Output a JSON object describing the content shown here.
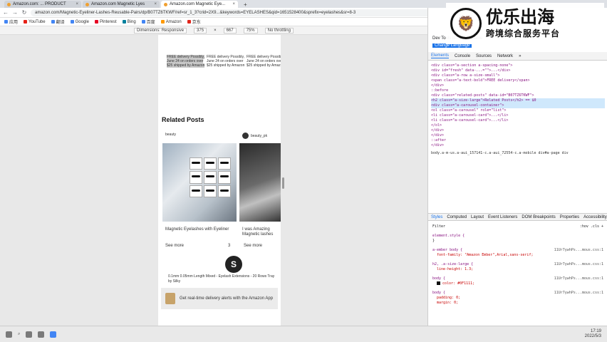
{
  "browser": {
    "tabs": [
      {
        "title": "Amazon.com: ... PRODUCT",
        "active": false
      },
      {
        "title": "Amazon.com Magnetic Lyes",
        "active": false
      },
      {
        "title": "Amazon.com Magnetic Eye...",
        "active": true
      }
    ],
    "url": "amazon.com/Magnetic-Eyeliner-Lashes-Reusable-Pairs/dp/B07TZ6TKWF/ref=sr_1_3?crid=2X9...&keywords=EYELASHES&qid=1651528400&sprefix=eyelashes&sr=8-3",
    "bookmarks": [
      "应用",
      "YouTube",
      "翻译",
      "Google",
      "Pinterest",
      "Bing",
      "百度",
      "Amazon",
      "京东"
    ]
  },
  "device_toolbar": {
    "device": "Dimensions: Responsive",
    "width": "375",
    "height": "667",
    "zoom": "75%",
    "throttle": "No throttling"
  },
  "page": {
    "delivery": [
      {
        "text": "FREE delivery Possibly, June 24 on orders over $25 shipped by Amazon"
      },
      {
        "text": "FREE delivery Possibly, June 24 on orders over $25 shipped by Amazon"
      },
      {
        "text": "FREE delivery Possibly, June 24 on orders over $25 shipped by Amazon"
      }
    ],
    "related_title": "Related Posts",
    "posts": [
      {
        "user": "beauty",
        "caption": "Magnetic Eyelashes with Eyeliner",
        "see_more": "See more",
        "count": "3"
      },
      {
        "user": "beauty_pk",
        "caption": "I was Amazing Magnetic lashes",
        "see_more": "See more",
        "count": ""
      }
    ],
    "badge": "S",
    "product_text": "0.1mm 0.05mm Length Mixed - Eyelash Extensions - 20 Rows Tray by Silky",
    "app_banner": "Get real-time delivery alerts with the Amazon App"
  },
  "devtools": {
    "tabs": [
      "Elements",
      "Console",
      "Sources",
      "Network",
      "»"
    ],
    "active_tab": "Elements",
    "header_1": "Dev Tools is now available",
    "header_2": "Change Language",
    "dom_lines": [
      "<div class=\"a-section a-spacing-none\">",
      "  <div id=\"fresh\" data-...=\"\">...</div>",
      "  <div class=\"a-row a-size-small\">",
      "    <span class=\"a-text-bold\">FREE delivery</span>",
      "  </div>",
      "  ::before",
      "  <div class=\"related-posts\" data-id=\"B07TZ6TKWF\">",
      "    <h2 class=\"a-size-large\">Related Posts</h2> == $0",
      "    <div class=\"a-carousel-container\">",
      "      <ol class=\"a-carousel\" role=\"list\">",
      "        <li class=\"a-carousel-card\">...</li>",
      "        <li class=\"a-carousel-card\">...</li>",
      "      </ol>",
      "    </div>",
      "  </div>",
      "  ::after",
      "</div>",
      "body.a-m-us.a-aui_157141-c.a-aui_72554-c.a-mobile  div#a-page  div"
    ],
    "subtabs": [
      "Styles",
      "Computed",
      "Layout",
      "Event Listeners",
      "DOM Breakpoints",
      "Properties",
      "Accessibility"
    ],
    "filter": "Filter",
    "filter_flags": ":hov .cls +",
    "styles": [
      {
        "selector": "element.style {",
        "source": "",
        "props": [
          "}"
        ]
      },
      {
        "selector": "a-ember body {",
        "source": "11Ur7ywhPs...mous.css:1",
        "props": [
          "font-family: \"Amazon Ember\",Arial,sans-serif;"
        ]
      },
      {
        "selector": "h2, .a-size-large {",
        "source": "11Ur7ywhPs...mous.css:1",
        "props": [
          "line-height: 1.3;"
        ]
      },
      {
        "selector": "body {",
        "source": "11Ur7ywhPs...mous.css:1",
        "props": [
          "color: #0F1111;"
        ]
      },
      {
        "selector": "body {",
        "source": "11Ur7ywhPs...mous.css:1",
        "props": [
          "padding: 0;",
          "margin: 0;"
        ]
      }
    ]
  },
  "watermark": {
    "big": "优乐出海",
    "small": "跨境综合服务平台"
  },
  "taskbar": {
    "time": "17:19",
    "date": "2022/5/3"
  }
}
